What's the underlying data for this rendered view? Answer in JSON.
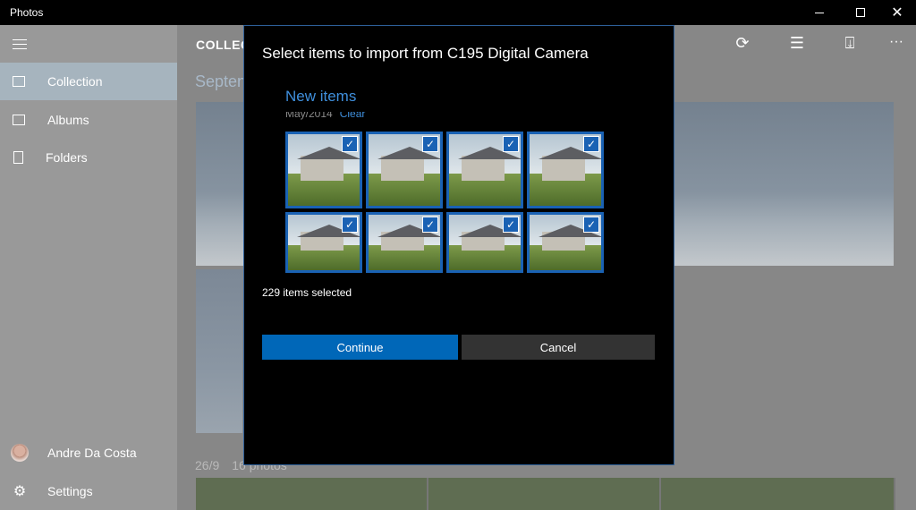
{
  "window": {
    "title": "Photos",
    "controls": {
      "minimize": "",
      "maximize": "",
      "close": "✕"
    }
  },
  "sidebar": {
    "items": [
      {
        "label": "Collection",
        "icon": "collection-icon",
        "active": true
      },
      {
        "label": "Albums",
        "icon": "albums-icon",
        "active": false
      },
      {
        "label": "Folders",
        "icon": "folders-icon",
        "active": false
      }
    ],
    "user": {
      "name": "Andre Da Costa"
    },
    "settings": {
      "label": "Settings",
      "icon": "gear-icon"
    }
  },
  "main": {
    "page_title": "COLLEC",
    "month_header": "Septen",
    "day_header": {
      "date": "26/9",
      "count": "16 photos"
    },
    "toolbar": {
      "refresh_icon": "refresh-icon",
      "select_icon": "select-icon",
      "import_icon": "import-icon",
      "more_icon": "more-icon",
      "more_label": "···"
    }
  },
  "dialog": {
    "title": "Select items to import from C195 Digital Camera",
    "section_title": "New items",
    "date_label": "May/2014",
    "clear_label": "Clear",
    "selected_count": "229 items selected",
    "thumbnails_selected": 8,
    "continue_label": "Continue",
    "cancel_label": "Cancel",
    "accent_color": "#0067b8"
  }
}
